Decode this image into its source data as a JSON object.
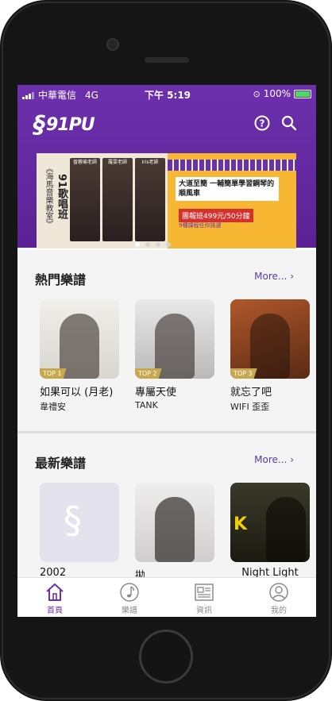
{
  "status_bar": {
    "carrier": "中華電信",
    "network": "4G",
    "time": "下午 5:19",
    "battery": "100%"
  },
  "header": {
    "logo_text": "91PU",
    "icons": [
      "help-icon",
      "search-icon"
    ]
  },
  "banner": {
    "vertical_title": "《海馬音樂教室》",
    "side_label": "91歌唱班",
    "teachers": [
      "晉蓉瑜老師",
      "羅雯老師",
      "Iris老師"
    ],
    "headline": "大道至簡 一輔簡單學習鋼琴的順風車",
    "price": "團報班499元/50分鐘",
    "sub": "9種課程任你挑選",
    "dots_total": 4,
    "dots_active": 1
  },
  "hot": {
    "title": "熱門樂譜",
    "more": "More...",
    "items": [
      {
        "title": "如果可以 (月老)",
        "artist": "韋禮安",
        "badge": "TOP 1"
      },
      {
        "title": "專屬天使",
        "artist": "TANK",
        "badge": "TOP 2"
      },
      {
        "title": "就忘了吧",
        "artist": "WIFI 歪歪",
        "badge": "TOP 3"
      }
    ]
  },
  "latest": {
    "title": "最新樂譜",
    "more": "More...",
    "items": [
      {
        "title": "2002"
      },
      {
        "title": "拋"
      },
      {
        "title": "Night Light"
      }
    ]
  },
  "tabbar": {
    "items": [
      {
        "label": "首頁",
        "icon": "home-icon",
        "active": true
      },
      {
        "label": "樂譜",
        "icon": "music-note-icon",
        "active": false
      },
      {
        "label": "資訊",
        "icon": "news-icon",
        "active": false
      },
      {
        "label": "我的",
        "icon": "profile-icon",
        "active": false
      }
    ]
  },
  "colors": {
    "brand": "#6d30ad",
    "accent_more": "#5b3aa0",
    "badge": "#c8a84e"
  }
}
